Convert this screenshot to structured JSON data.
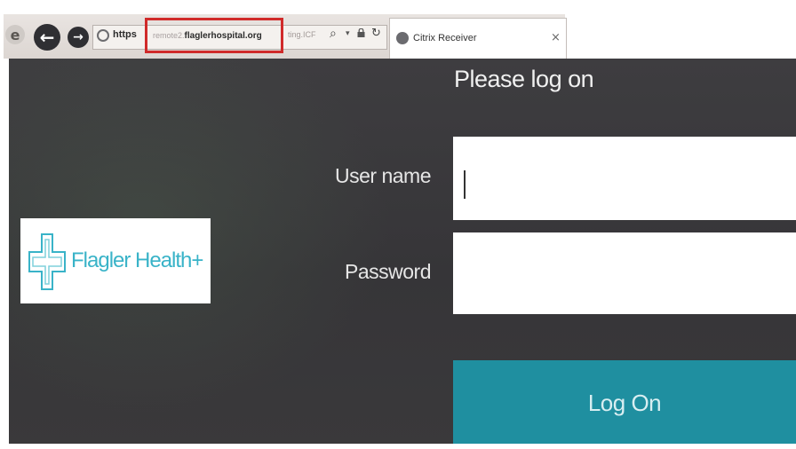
{
  "browser": {
    "url_scheme": "https",
    "url_subdomain": "remote2.",
    "url_host": "flaglerhospital.org",
    "url_tail": "ting.ICF",
    "tab_title": "Citrix Receiver",
    "tab_close": "×",
    "icons": [
      "ie-logo-icon",
      "back-arrow-icon",
      "forward-arrow-icon",
      "globe-icon",
      "search-icon",
      "dropdown-icon",
      "lock-icon",
      "refresh-icon",
      "citrix-icon",
      "close-icon"
    ],
    "highlight_color": "#d02a2a"
  },
  "page": {
    "heading": "Please log on",
    "logo_text": "Flagler Health+",
    "username_label": "User name",
    "username_value": "",
    "password_label": "Password",
    "password_value": "",
    "logon_label": "Log On",
    "colors": {
      "background": "#3a393b",
      "button": "#1f8fa0",
      "logo_text": "#39b3c8"
    }
  }
}
